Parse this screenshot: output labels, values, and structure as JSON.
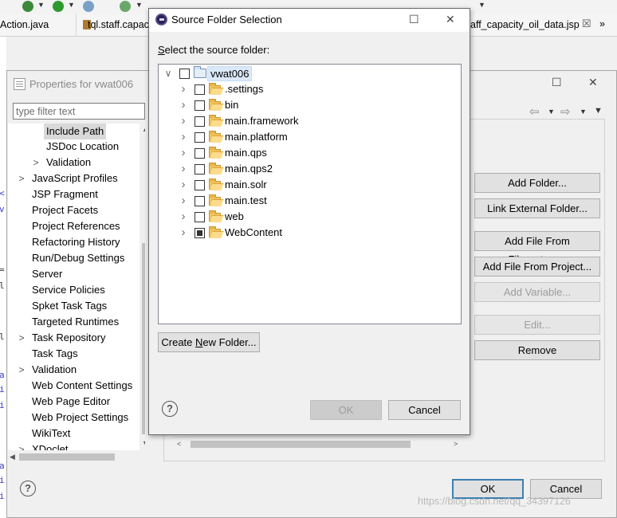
{
  "editor": {
    "tabs": [
      {
        "label": "Action.java"
      },
      {
        "label": "tql.staff.capac"
      },
      {
        "label": "aff_capacity_oil_data.jsp"
      }
    ],
    "tab_close_glyph": "☒",
    "overflow_glyph": "»",
    "gutter_chars": [
      "<",
      "v",
      "=",
      "l",
      "l",
      "a",
      "i",
      "i",
      "a",
      "i",
      "i"
    ]
  },
  "properties_dialog": {
    "title": "Properties for vwat006",
    "filter_placeholder": "type filter text",
    "tree_items": [
      {
        "label": "Include Path",
        "indent": 2,
        "expander": "",
        "selected": true
      },
      {
        "label": "JSDoc Location",
        "indent": 2,
        "expander": "",
        "selected": false
      },
      {
        "label": "Validation",
        "indent": 2,
        "expander": ">",
        "selected": false
      },
      {
        "label": "JavaScript Profiles",
        "indent": 1,
        "expander": ">",
        "selected": false
      },
      {
        "label": "JSP Fragment",
        "indent": 1,
        "expander": "",
        "selected": false
      },
      {
        "label": "Project Facets",
        "indent": 1,
        "expander": "",
        "selected": false
      },
      {
        "label": "Project References",
        "indent": 1,
        "expander": "",
        "selected": false
      },
      {
        "label": "Refactoring History",
        "indent": 1,
        "expander": "",
        "selected": false
      },
      {
        "label": "Run/Debug Settings",
        "indent": 1,
        "expander": "",
        "selected": false
      },
      {
        "label": "Server",
        "indent": 1,
        "expander": "",
        "selected": false
      },
      {
        "label": "Service Policies",
        "indent": 1,
        "expander": "",
        "selected": false
      },
      {
        "label": "Spket Task Tags",
        "indent": 1,
        "expander": "",
        "selected": false
      },
      {
        "label": "Targeted Runtimes",
        "indent": 1,
        "expander": "",
        "selected": false
      },
      {
        "label": "Task Repository",
        "indent": 1,
        "expander": ">",
        "selected": false
      },
      {
        "label": "Task Tags",
        "indent": 1,
        "expander": "",
        "selected": false
      },
      {
        "label": "Validation",
        "indent": 1,
        "expander": ">",
        "selected": false
      },
      {
        "label": "Web Content Settings",
        "indent": 1,
        "expander": "",
        "selected": false
      },
      {
        "label": "Web Page Editor",
        "indent": 1,
        "expander": "",
        "selected": false
      },
      {
        "label": "Web Project Settings",
        "indent": 1,
        "expander": "",
        "selected": false
      },
      {
        "label": "WikiText",
        "indent": 1,
        "expander": "",
        "selected": false
      },
      {
        "label": "XDoclet",
        "indent": 1,
        "expander": ">",
        "selected": false
      }
    ],
    "buttons": {
      "add_folder": "Add Folder...",
      "link_external_folder": "Link External Folder...",
      "add_file_from_filesystem": "Add File From Filesystem...",
      "add_file_from_project": "Add File From Project...",
      "add_variable": "Add Variable...",
      "edit": "Edit...",
      "remove": "Remove",
      "ok": "OK",
      "cancel": "Cancel"
    },
    "help_glyph": "?",
    "watermark": "https://blog.csdn.net/qq_34397126"
  },
  "source_folder_dialog": {
    "title": "Source Folder Selection",
    "instruction_underlined": "S",
    "instruction_rest": "elect the source folder:",
    "root": {
      "label": "vwat006",
      "checked": false,
      "expanded": true
    },
    "folders": [
      {
        "label": ".settings",
        "checked": false,
        "partial": false
      },
      {
        "label": "bin",
        "checked": false,
        "partial": false
      },
      {
        "label": "main.framework",
        "checked": false,
        "partial": false
      },
      {
        "label": "main.platform",
        "checked": false,
        "partial": false
      },
      {
        "label": "main.qps",
        "checked": false,
        "partial": false
      },
      {
        "label": "main.qps2",
        "checked": false,
        "partial": false
      },
      {
        "label": "main.solr",
        "checked": false,
        "partial": false
      },
      {
        "label": "main.test",
        "checked": false,
        "partial": false
      },
      {
        "label": "web",
        "checked": false,
        "partial": false
      },
      {
        "label": "WebContent",
        "checked": false,
        "partial": true
      }
    ],
    "create_folder": {
      "pre": "Create ",
      "underlined": "N",
      "post": "ew Folder..."
    },
    "ok_label": "OK",
    "cancel_label": "Cancel",
    "help_glyph": "?"
  }
}
